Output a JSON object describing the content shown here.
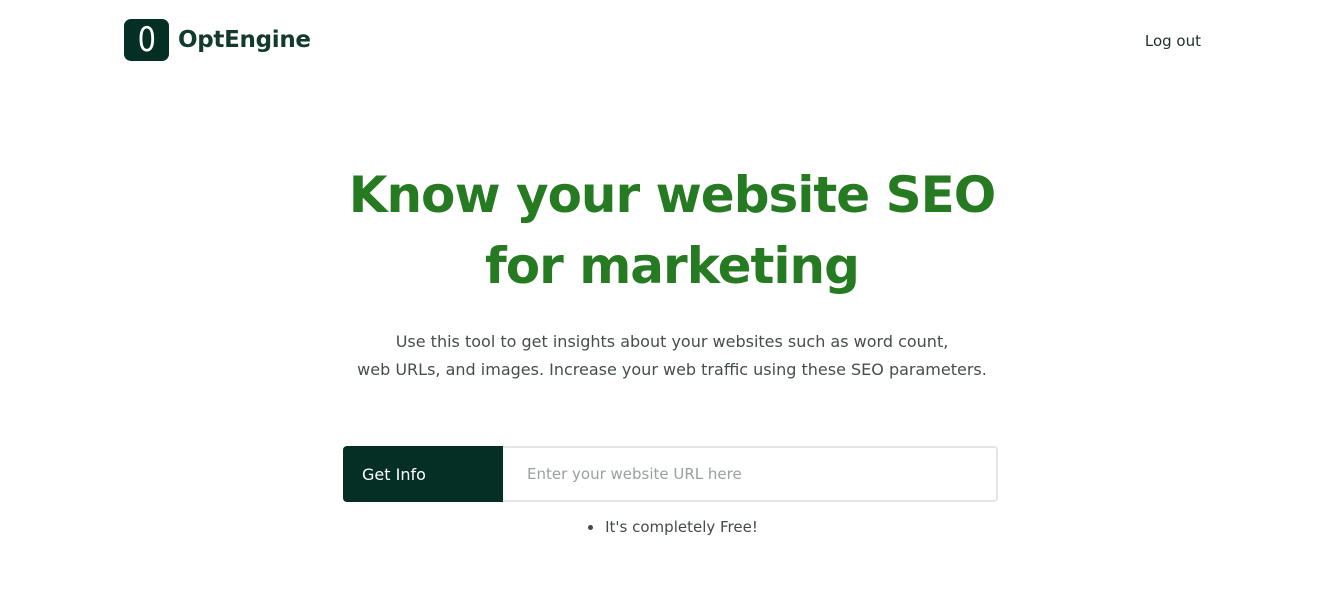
{
  "header": {
    "logo_letter": "0",
    "brand_name": "OptEngine",
    "logout_label": "Log out"
  },
  "hero": {
    "title_line_1": "Know your website SEO",
    "title_line_2": "for marketing",
    "description_line_1": "Use this tool to get insights about your websites such as word count,",
    "description_line_2": "web URLs, and images. Increase your web traffic using these SEO parameters."
  },
  "form": {
    "button_label": "Get Info",
    "url_placeholder": "Enter your website URL here",
    "url_value": ""
  },
  "notes": [
    "It's completely Free!"
  ],
  "colors": {
    "brand_dark": "#052f24",
    "title_green": "#267a21",
    "background": "#ffffff"
  },
  "icons": {
    "bullet": "bullet-dot-icon"
  }
}
